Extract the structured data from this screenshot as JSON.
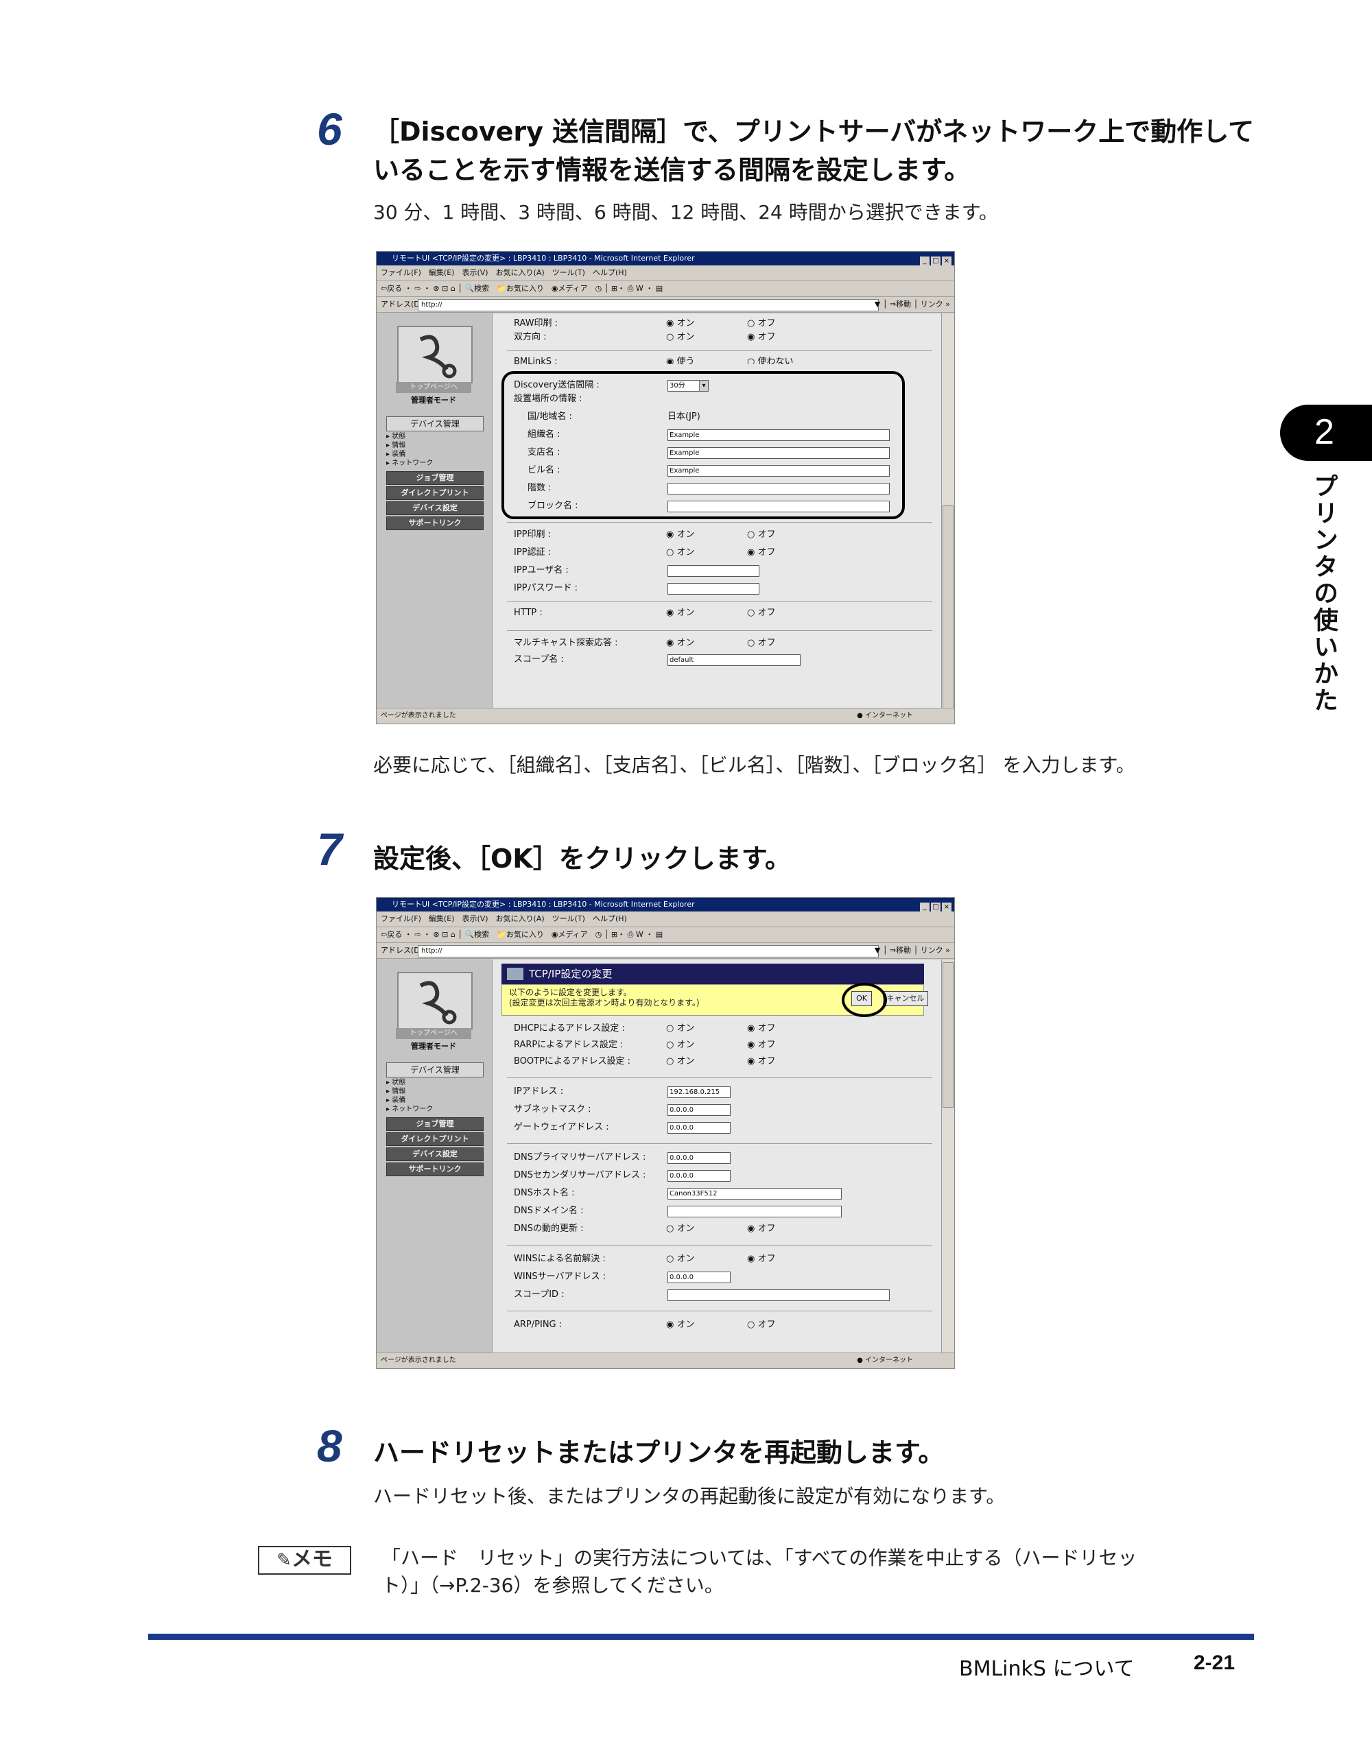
{
  "steps": [
    {
      "number": "6",
      "heading_line1": "［Discovery 送信間隔］で、プリントサーバがネットワーク上で動作して",
      "heading_line2": "いることを示す情報を送信する間隔を設定します。",
      "desc": "30 分、1 時間、3 時間、6 時間、12 時間、24 時間から選択できます。"
    },
    {
      "number": "7",
      "heading_line1": "設定後、［OK］をクリックします。"
    },
    {
      "number": "8",
      "heading_line1": "ハードリセットまたはプリンタを再起動します。",
      "desc": "ハードリセット後、またはプリンタの再起動後に設定が有効になります。"
    }
  ],
  "after_screenshot1": "必要に応じて、［組織名］、［支店名］、［ビル名］、［階数］、［ブロック名］ を入力します。",
  "memo": {
    "label": "メモ",
    "line1": "「ハード　リセット」の実行方法については、「すべての作業を中止する（ハードリセッ",
    "line2": "ト）」（→P.2-36）を参照してください。"
  },
  "side_tab": {
    "number": "2",
    "text": "プリンタの使いかた"
  },
  "footer": {
    "section": "BMLinkS について",
    "page": "2-21"
  },
  "browser": {
    "title": "リモートUI <TCP/IP設定の変更> : LBP3410 : LBP3410 - Microsoft Internet Explorer",
    "menu": "ファイル(F)　編集(E)　表示(V)　お気に入り(A)　ツール(T)　ヘルプ(H)",
    "toolbar": "⇦戻る ・ ⇨ ・ ⊗ ⊡ ⌂ │ 🔍検索　📁お気に入り　◉メディア　◷ │ ⊞・ ⎙ W ・ ▤",
    "address_label": "アドレス(D)",
    "address": "http://",
    "go": "▼ │ ⇒移動 │ リンク »",
    "status": "ページが表示されました",
    "zone": "● インターネット",
    "win_buttons": [
      "_",
      "□",
      "×"
    ]
  },
  "leftnav": {
    "top_page": "トップページへ",
    "admin_mode": "管理者モード",
    "device_mgmt": "デバイス管理",
    "links": [
      "▸ 状態",
      "▸ 情報",
      "▸ 装備",
      "▸ ネットワーク"
    ],
    "job_mgmt": "ジョブ管理",
    "direct_print": "ダイレクトプリント",
    "device_settings": "デバイス設定",
    "support_link": "サポートリンク"
  },
  "ss1": {
    "raw_print": "RAW印刷 :",
    "bidir": "双方向 :",
    "bmlinks_label": "BMLinkS :",
    "on": "◉ オン",
    "off": "○ オフ",
    "on_unsel": "○ オン",
    "off_sel": "◉ オフ",
    "use": "◉ 使う",
    "nouse": "○ 使わない",
    "discovery": "Discovery送信間隔 :",
    "discovery_val": "30分",
    "location_info": "設置場所の情報 :",
    "country": "国/地域名 :",
    "country_val": "日本(JP)",
    "org": "組織名 :",
    "branch": "支店名 :",
    "building": "ビル名 :",
    "floor": "階数 :",
    "block": "ブロック名 :",
    "example": "Example",
    "ipp_print": "IPP印刷 :",
    "ipp_auth": "IPP認証 :",
    "ipp_user": "IPPユーザ名 :",
    "ipp_pass": "IPPパスワード :",
    "http": "HTTP :",
    "multicast": "マルチキャスト探索応答 :",
    "scope": "スコープ名 :",
    "scope_val": "default"
  },
  "ss2": {
    "header": "TCP/IP設定の変更",
    "notice1": "以下のように設定を変更します。",
    "notice2": "(設定変更は次回主電源オン時より有効となります。)",
    "ok": "OK",
    "cancel": "キャンセル",
    "dhcp": "DHCPによるアドレス設定 :",
    "rarp": "RARPによるアドレス設定 :",
    "bootp": "BOOTPによるアドレス設定 :",
    "on_unsel": "○ オン",
    "off_sel": "◉ オフ",
    "on": "◉ オン",
    "off": "○ オフ",
    "ip": "IPアドレス :",
    "ip_val": "192.168.0.215",
    "subnet": "サブネットマスク :",
    "subnet_val": "0.0.0.0",
    "gateway": "ゲートウェイアドレス :",
    "gateway_val": "0.0.0.0",
    "dns1": "DNSプライマリサーバアドレス :",
    "dns1_val": "0.0.0.0",
    "dns2": "DNSセカンダリサーバアドレス :",
    "dns2_val": "0.0.0.0",
    "dnshost": "DNSホスト名 :",
    "dnshost_val": "Canon33F512",
    "dnsdomain": "DNSドメイン名 :",
    "dnsdyn": "DNSの動的更新 :",
    "wins": "WINSによる名前解決 :",
    "winsserver": "WINSサーバアドレス :",
    "winsserver_val": "0.0.0.0",
    "scopeid": "スコープID :",
    "arp": "ARP/PING :"
  }
}
